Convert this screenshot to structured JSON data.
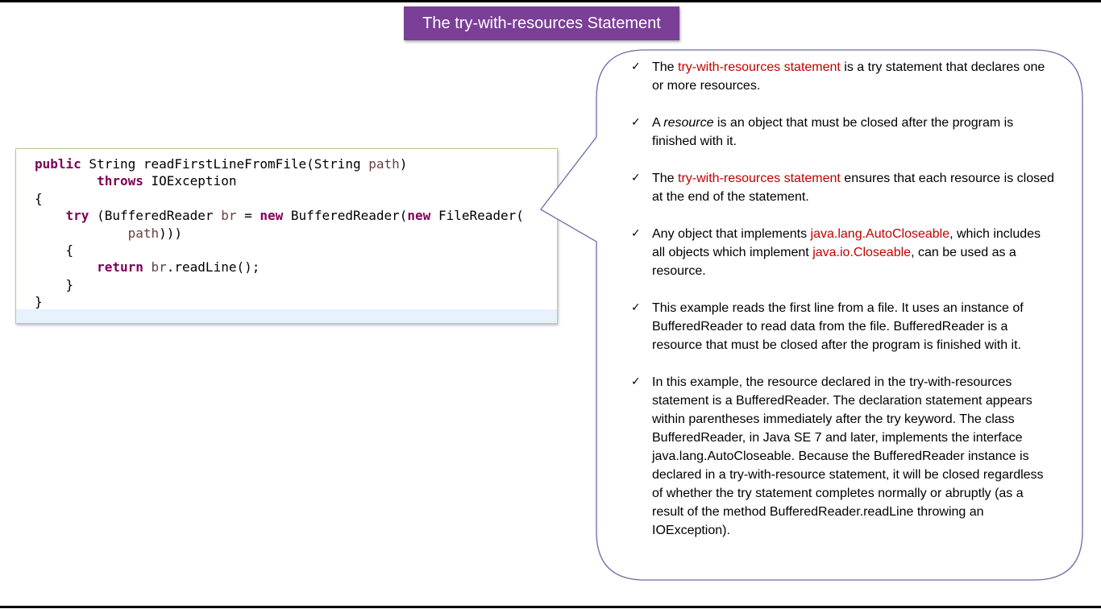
{
  "title": "The try-with-resources Statement",
  "code": {
    "lines": [
      [
        {
          "t": "public",
          "c": "kw"
        },
        {
          "t": " String readFirstLineFromFile(String "
        },
        {
          "t": "path",
          "c": "var"
        },
        {
          "t": ")"
        }
      ],
      [
        {
          "t": "        "
        },
        {
          "t": "throws",
          "c": "kw"
        },
        {
          "t": " IOException"
        }
      ],
      [
        {
          "t": "{"
        }
      ],
      [
        {
          "t": "    "
        },
        {
          "t": "try",
          "c": "kw"
        },
        {
          "t": " (BufferedReader "
        },
        {
          "t": "br",
          "c": "var"
        },
        {
          "t": " = "
        },
        {
          "t": "new",
          "c": "kw"
        },
        {
          "t": " BufferedReader("
        },
        {
          "t": "new",
          "c": "kw"
        },
        {
          "t": " FileReader("
        }
      ],
      [
        {
          "t": "            "
        },
        {
          "t": "path",
          "c": "var"
        },
        {
          "t": ")))"
        }
      ],
      [
        {
          "t": "    {"
        }
      ],
      [
        {
          "t": "        "
        },
        {
          "t": "return",
          "c": "kw"
        },
        {
          "t": " "
        },
        {
          "t": "br",
          "c": "var"
        },
        {
          "t": ".readLine();"
        }
      ],
      [
        {
          "t": "    }"
        }
      ],
      [
        {
          "t": "}"
        }
      ]
    ]
  },
  "notes": [
    [
      {
        "t": "The "
      },
      {
        "t": "try-with-resources statement",
        "h": true
      },
      {
        "t": " is a try statement that declares one or more resources."
      }
    ],
    [
      {
        "t": "A "
      },
      {
        "t": "resource",
        "i": true
      },
      {
        "t": " is an object that must be closed after the program is finished with it."
      }
    ],
    [
      {
        "t": "The "
      },
      {
        "t": "try-with-resources statement",
        "h": true
      },
      {
        "t": " ensures that each resource is closed at the end of the statement."
      }
    ],
    [
      {
        "t": "Any object that implements "
      },
      {
        "t": "java.lang.AutoCloseable",
        "h": true
      },
      {
        "t": ", which includes all objects which implement "
      },
      {
        "t": "java.io.Closeable",
        "h": true
      },
      {
        "t": ", can be used as a resource."
      }
    ],
    [
      {
        "t": "This example reads the first line from a file. It uses an instance of BufferedReader to read data from the file. BufferedReader is a resource that must be closed after the program is finished with it."
      }
    ],
    [
      {
        "t": "In this example, the resource declared in the try-with-resources statement is a BufferedReader. The declaration statement appears within parentheses immediately after the try keyword. The class BufferedReader, in Java SE 7 and later, implements the interface java.lang.AutoCloseable. Because the BufferedReader instance is declared in a try-with-resource statement, it will be closed regardless of whether the try statement completes normally or abruptly (as a result of the method BufferedReader.readLine throwing an IOException)."
      }
    ]
  ],
  "check_glyph": "✓",
  "colors": {
    "title_bg": "#7a3f96",
    "keyword": "#7f0055",
    "variable": "#6a3e3e",
    "highlight": "#c00000",
    "callout_border": "#6b6aa8"
  }
}
